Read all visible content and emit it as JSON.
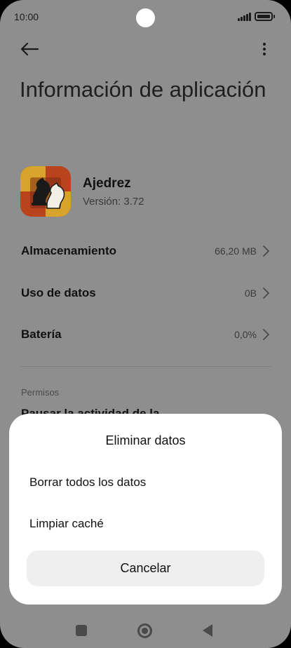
{
  "status_bar": {
    "time": "10:00"
  },
  "page": {
    "title": "Información de aplicación"
  },
  "app": {
    "name": "Ajedrez",
    "version": "Versión: 3.72"
  },
  "rows": [
    {
      "label": "Almacenamiento",
      "value": "66,20 MB"
    },
    {
      "label": "Uso de datos",
      "value": "0B"
    },
    {
      "label": "Batería",
      "value": "0,0%"
    }
  ],
  "permissions": {
    "section_label": "Permisos",
    "clipped_item": "Pausar la actividad de la"
  },
  "dialog": {
    "title": "Eliminar datos",
    "options": [
      "Borrar todos los datos",
      "Limpiar caché"
    ],
    "cancel_label": "Cancelar"
  },
  "colors": {
    "scrim_background": "#8e8e8e",
    "sheet_background": "#ffffff",
    "cancel_background": "#efefef"
  },
  "icons": {
    "back": "arrow-left-icon",
    "more": "more-vertical-icon",
    "chevron": "chevron-right-icon",
    "app": "chess-knight-icon",
    "nav_recents": "square-icon",
    "nav_home": "circle-icon",
    "nav_back": "triangle-back-icon"
  }
}
